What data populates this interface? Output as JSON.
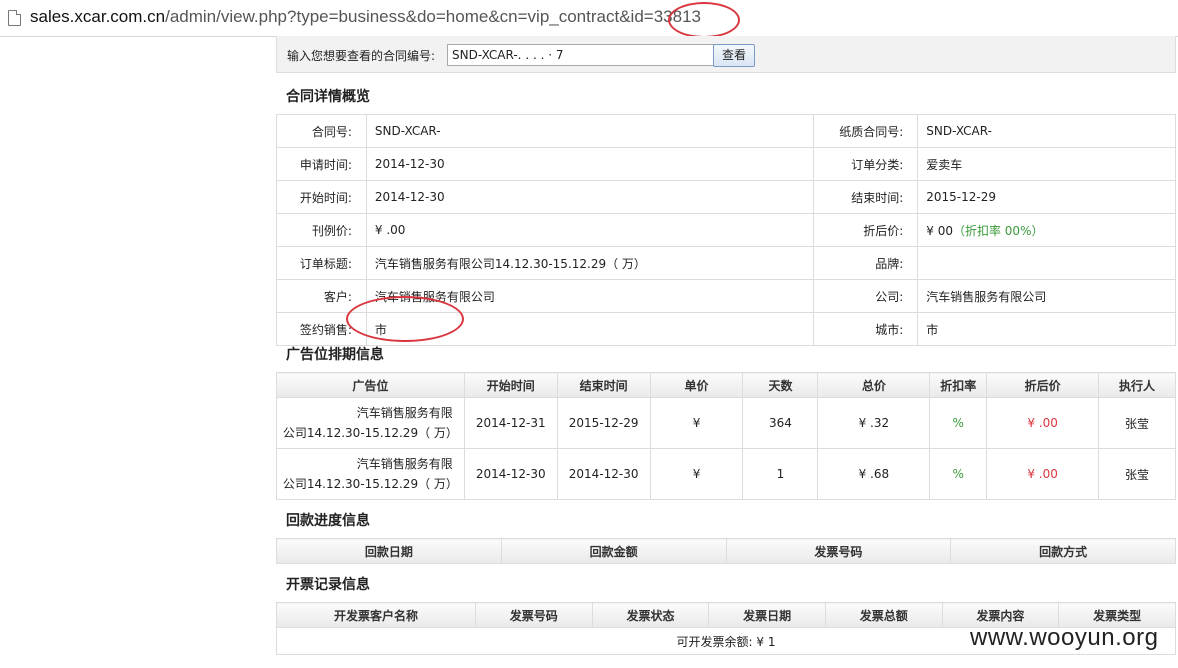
{
  "browser": {
    "url_host": "sales.xcar.com.cn",
    "url_path": "/admin/view.php?type=business&do=home&cn=vip_contract&id=33813"
  },
  "search": {
    "label": "输入您想要查看的合同编号:",
    "value": "SND-XCAR-. . . . ·  7",
    "button": "查看"
  },
  "overview": {
    "title": "合同详情概览",
    "rows": [
      {
        "k1": "合同号:",
        "v1": "SND-XCAR-",
        "k2": "纸质合同号:",
        "v2": "SND-XCAR-"
      },
      {
        "k1": "申请时间:",
        "v1": "2014-12-30",
        "k2": "订单分类:",
        "v2": "爱卖车"
      },
      {
        "k1": "开始时间:",
        "v1": "2014-12-30",
        "k2": "结束时间:",
        "v2": "2015-12-29"
      },
      {
        "k1": "刊例价:",
        "v1": "¥      .00",
        "k2": "折后价:",
        "v2": "¥        00"
      },
      {
        "k1": "订单标题:",
        "v1": "汽车销售服务有限公司14.12.30-15.12.29（   万）",
        "k2": "品牌:",
        "v2": ""
      },
      {
        "k1": "客户:",
        "v1": "汽车销售服务有限公司",
        "k2": "公司:",
        "v2": "汽车销售服务有限公司"
      },
      {
        "k1": "签约销售:",
        "v1": "市",
        "k2": "城市:",
        "v2": "市"
      }
    ],
    "discount_note": "（折扣率    00%）"
  },
  "ads": {
    "title": "广告位排期信息",
    "headers": [
      "广告位",
      "开始时间",
      "结束时间",
      "单价",
      "天数",
      "总价",
      "折扣率",
      "折后价",
      "执行人"
    ],
    "rows": [
      {
        "pos1": "汽车销售服务有限",
        "pos2": "公司14.12.30-15.12.29（     万）",
        "start": "2014-12-31",
        "end": "2015-12-29",
        "price": "¥",
        "days": "364",
        "total": "¥      .32",
        "rate": "%",
        "after": "¥       .00",
        "exec": "张莹"
      },
      {
        "pos1": "汽车销售服务有限",
        "pos2": "公司14.12.30-15.12.29（     万）",
        "start": "2014-12-30",
        "end": "2014-12-30",
        "price": "¥",
        "days": "1",
        "total": "¥       .68",
        "rate": "%",
        "after": "¥    .00",
        "exec": "张莹"
      }
    ]
  },
  "payment": {
    "title": "回款进度信息",
    "headers": [
      "回款日期",
      "回款金额",
      "发票号码",
      "回款方式"
    ]
  },
  "invoice": {
    "title": "开票记录信息",
    "headers": [
      "开发票客户名称",
      "发票号码",
      "发票状态",
      "发票日期",
      "发票总额",
      "发票内容",
      "发票类型"
    ],
    "balance": "可开发票余额: ¥      1"
  },
  "watermark": "www.wooyun.org",
  "colors": {
    "highlight_ring": "#d9363e",
    "discount_green": "#3a9a3a",
    "price_red": "#d9363e"
  }
}
